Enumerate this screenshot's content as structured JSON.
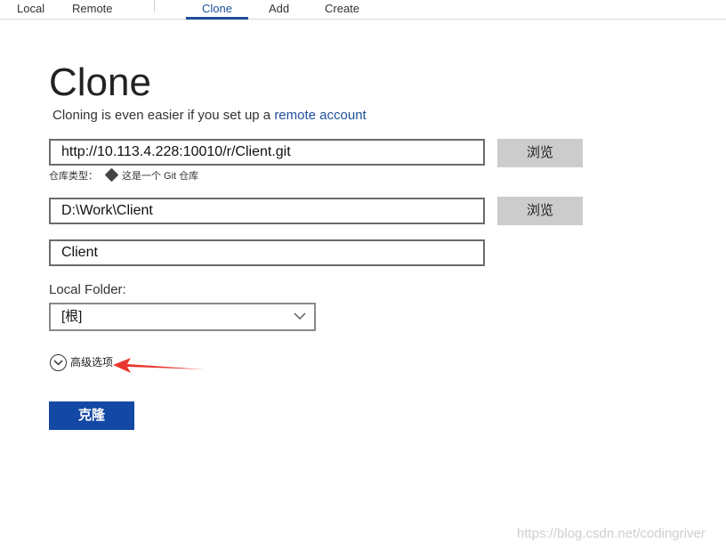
{
  "tabs": {
    "local": "Local",
    "remote": "Remote",
    "clone": "Clone",
    "add": "Add",
    "create": "Create",
    "active": "Clone"
  },
  "page": {
    "title": "Clone",
    "subtitle_text": "Cloning is even easier if you set up a ",
    "subtitle_link": "remote account"
  },
  "source_url": {
    "value": "http://10.113.4.228:10010/r/Client.git",
    "browse_label": "浏览"
  },
  "repo_type": {
    "label": "仓库类型：",
    "icon": "git-icon",
    "value": "这是一个 Git 仓库"
  },
  "destination_path": {
    "value": "D:\\Work\\Client",
    "browse_label": "浏览"
  },
  "name": {
    "value": "Client"
  },
  "local_folder": {
    "label": "Local Folder:",
    "selected": "[根]"
  },
  "advanced": {
    "label": "高级选项",
    "icon": "chevron-down-circle-icon"
  },
  "clone_button": {
    "label": "克隆"
  },
  "annotation": {
    "arrow_color": "#e8382f"
  },
  "colors": {
    "accent": "#1e4e9a",
    "primary_button": "#1448a5",
    "secondary_button": "#cccccc"
  },
  "watermark": "https://blog.csdn.net/codingriver"
}
